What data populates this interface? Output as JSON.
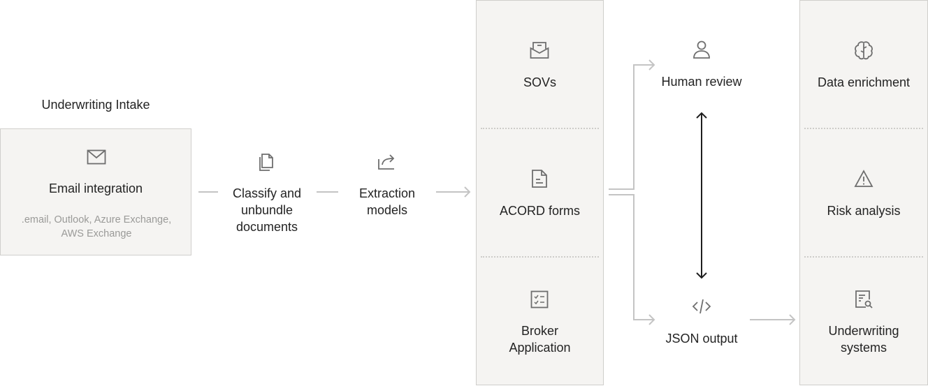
{
  "colors": {
    "box_fill": "#f5f4f2",
    "box_border": "#cfcecb",
    "connector": "#c4c4c4",
    "bidirectional_arrow": "#1e1e1e",
    "icon": "#6e6e6e",
    "text": "#232323",
    "subtext": "#9a9a98"
  },
  "intake": {
    "title": "Underwriting Intake",
    "email": {
      "icon": "envelope-icon",
      "label": "Email integration",
      "sub_line1": ".email, Outlook, Azure Exchange,",
      "sub_line2": "AWS Exchange"
    }
  },
  "steps": [
    {
      "icon": "documents-icon",
      "line1": "Classify and",
      "line2": "unbundle",
      "line3": "documents"
    },
    {
      "icon": "share-export-icon",
      "line1": "Extraction",
      "line2": "models"
    }
  ],
  "document_types": [
    {
      "icon": "inbox-tray-icon",
      "label": "SOVs"
    },
    {
      "icon": "file-text-icon",
      "label": "ACORD forms"
    },
    {
      "icon": "checklist-icon",
      "line1": "Broker",
      "line2": "Application"
    }
  ],
  "outputs": {
    "human_review": {
      "icon": "user-icon",
      "label": "Human review"
    },
    "json_output": {
      "icon": "code-icon",
      "label": "JSON output"
    }
  },
  "destinations": [
    {
      "icon": "brain-icon",
      "label": "Data enrichment"
    },
    {
      "icon": "warning-triangle-icon",
      "label": "Risk analysis"
    },
    {
      "icon": "document-search-icon",
      "line1": "Underwriting",
      "line2": "systems"
    }
  ]
}
